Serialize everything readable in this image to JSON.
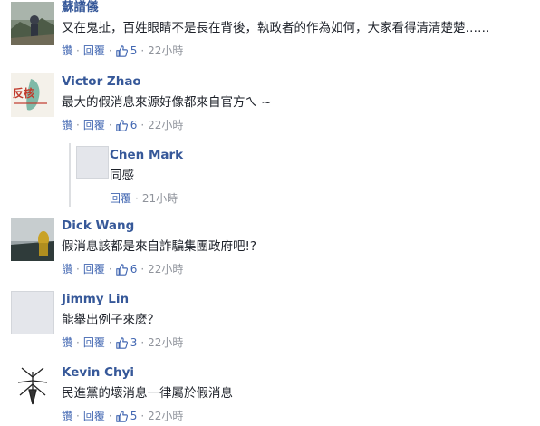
{
  "comments": [
    {
      "name": "蘇譜儀",
      "text": "又在鬼扯，百姓眼睛不是長在背後，執政者的作為如何，大家看得清清楚楚……",
      "actions": {
        "read": "讚",
        "reply": "回覆",
        "likes": "5",
        "time": "22小時"
      }
    },
    {
      "name": "Victor Zhao",
      "text": "最大的假消息來源好像都來自官方ㄟ ~",
      "actions": {
        "read": "讚",
        "reply": "回覆",
        "likes": "6",
        "time": "22小時"
      },
      "avatar_text": "反核"
    },
    {
      "name": "Dick Wang",
      "text": "假消息該都是來自詐騙集團政府吧!?",
      "actions": {
        "read": "讚",
        "reply": "回覆",
        "likes": "6",
        "time": "22小時"
      }
    },
    {
      "name": "Jimmy Lin",
      "text": "能舉出例子來麼？",
      "actions": {
        "read": "讚",
        "reply": "回覆",
        "likes": "3",
        "time": "22小時"
      }
    },
    {
      "name": "Kevin Chyi",
      "text": "民進黨的壞消息一律屬於假消息",
      "actions": {
        "read": "讚",
        "reply": "回覆",
        "likes": "5",
        "time": "22小時"
      }
    }
  ],
  "reply": {
    "name": "Chen Mark",
    "text": "同感",
    "actions": {
      "reply": "回覆",
      "time": "21小時"
    }
  },
  "separator": "·",
  "colors": {
    "link": "#365899",
    "action": "#4267b2",
    "meta": "#90949c",
    "text": "#1d2129"
  },
  "icons": {
    "like": "thumbs-up-icon"
  }
}
